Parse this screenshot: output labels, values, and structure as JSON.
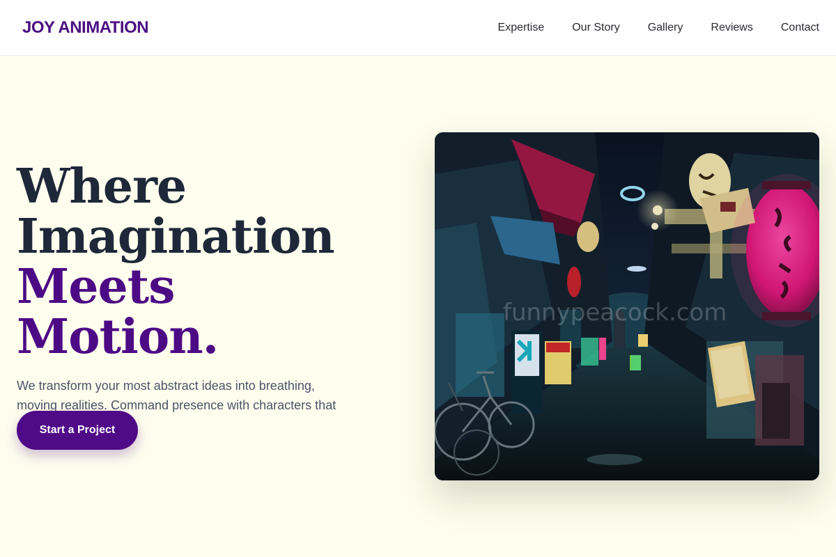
{
  "header": {
    "brand": "JOY ANIMATION",
    "nav": [
      "Expertise",
      "Our Story",
      "Gallery",
      "Reviews",
      "Contact"
    ]
  },
  "hero": {
    "headline_line1": "Where",
    "headline_line2": "Imagination",
    "headline_line3": "Meets Motion.",
    "subtext": "We transform your most abstract ideas into breathing, moving realities. Command presence with characters that captivate.",
    "cta_label": "Start a Project",
    "image_watermark": "funnypeacock.com"
  },
  "colors": {
    "brand": "#4a0e82",
    "accent": "#4d0a85",
    "background": "#fefeee",
    "headline": "#1e2839",
    "body_text": "#4b5466"
  },
  "icons": {
    "hero_image": "neon-alley-photo"
  }
}
